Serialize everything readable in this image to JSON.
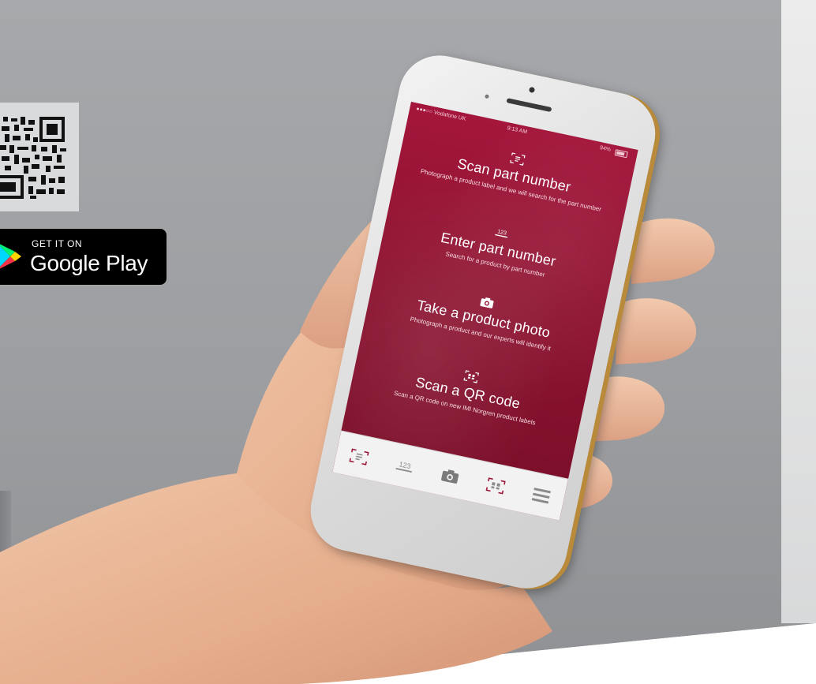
{
  "badge": {
    "small_text": "GET IT ON",
    "large_text": "Google Play",
    "logo_icon": "google-play-icon"
  },
  "qr": {
    "icon": "qr-code-icon"
  },
  "phone": {
    "status": {
      "carrier": "●●●○○ Vodafone UK",
      "time": "9:13 AM",
      "battery": "94%"
    },
    "menu": [
      {
        "title": "Scan part number",
        "subtitle": "Photograph a product label and we will search for the part number",
        "icon": "scan-part-icon"
      },
      {
        "title": "Enter part number",
        "subtitle": "Search for a product by part number",
        "icon": "keypad-icon"
      },
      {
        "title": "Take a product photo",
        "subtitle": "Photograph a product and our experts will identify it",
        "icon": "camera-icon"
      },
      {
        "title": "Scan a QR code",
        "subtitle": "Scan a QR code on new IMI Norgren product labels",
        "icon": "qr-scan-icon"
      }
    ],
    "tabs": [
      {
        "icon": "scan-part-icon"
      },
      {
        "icon": "keypad-icon"
      },
      {
        "icon": "camera-icon"
      },
      {
        "icon": "qr-scan-icon"
      },
      {
        "icon": "hamburger-menu-icon"
      }
    ],
    "colors": {
      "brand": "#9b1438",
      "tab_bar": "#f2f2f2",
      "icon_gray": "#8a8a8a"
    }
  }
}
